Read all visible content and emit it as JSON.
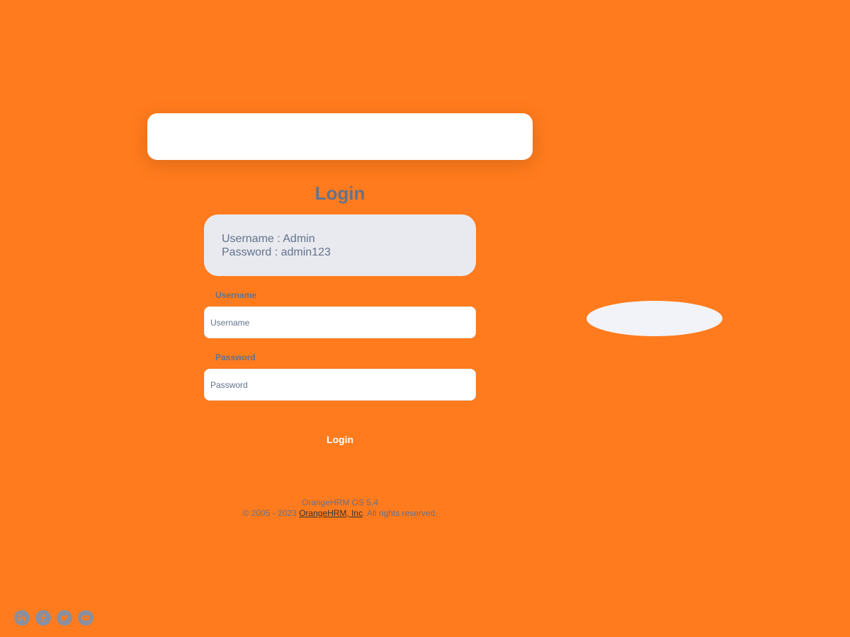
{
  "login": {
    "title": "Login",
    "credentials": {
      "username_line": "Username : Admin",
      "password_line": "Password : admin123"
    },
    "username_label": "Username",
    "username_placeholder": "Username",
    "password_label": "Password",
    "password_placeholder": "Password",
    "submit_label": "Login"
  },
  "footer": {
    "version": "OrangeHRM OS 5.4",
    "copyright_prefix": "© 2005 - 2023 ",
    "company_link": "OrangeHRM, Inc",
    "copyright_suffix": ". All rights reserved."
  },
  "social": {
    "icons": [
      "linkedin-icon",
      "facebook-icon",
      "twitter-icon",
      "youtube-icon"
    ]
  },
  "colors": {
    "background": "#ff7b1d",
    "text": "#64728c",
    "credentials_bg": "#e8eaef"
  }
}
